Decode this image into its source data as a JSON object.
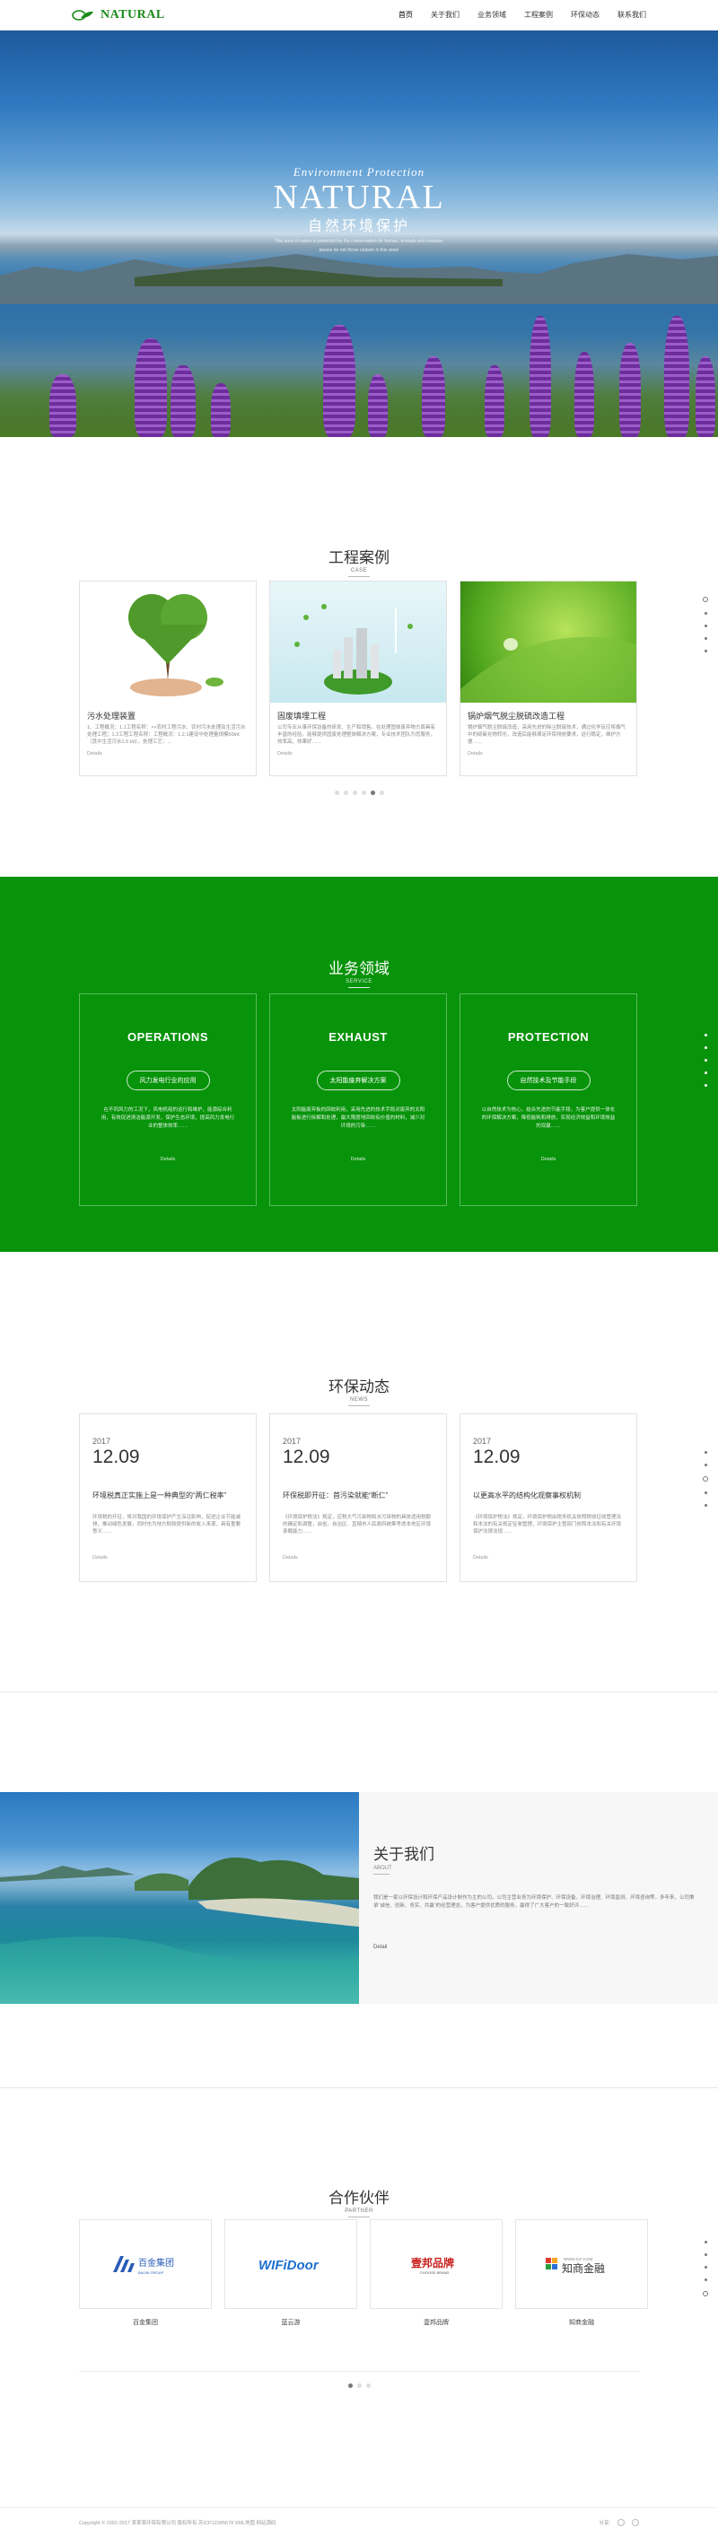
{
  "header": {
    "logo_text": "NATURAL",
    "nav": [
      "首页",
      "关于我们",
      "业务领域",
      "工程案例",
      "环保动态",
      "联系我们"
    ]
  },
  "hero": {
    "sub_en": "Environment Protection",
    "title": "NATURAL",
    "cn": "自然环境保护",
    "line1": "This area of nature is protected by the conservation for human, animals and creature.",
    "line2": "please do not throw rubbish in this area!"
  },
  "case": {
    "title": "工程案例",
    "en": "CASE",
    "cards": [
      {
        "name": "污水处理装置",
        "desc": "1、工程概况：1.1工程名称：××农村工程污水、农村污水处理及生活污水处理工程；1.2工程工程名称：工程概况：1.2.1建设中处理量规模50t/d（其中生活污水1.5 t/d），处理工艺：...",
        "more": "Details"
      },
      {
        "name": "固废填埋工程",
        "desc": "公司专业从事环保设备的研发、生产和销售。在处理固体废弃物方面具有丰富的经验，能够提供固废处理整体解决方案，专业技术团队为您服务，效率高，效果好……",
        "more": "Details"
      },
      {
        "name": "锅炉烟气脱尘脱硫改造工程",
        "desc": "锅炉烟气脱尘脱硫改造，采用先进的除尘脱硫技术，通过化学反应将烟气中的硫氧化物转化，改造后能够满足环保排放要求，运行稳定，维护方便……",
        "more": "Details"
      }
    ],
    "dots": 6,
    "active_dot": 4
  },
  "service": {
    "title": "业务领域",
    "en": "SERVICE",
    "cards": [
      {
        "name": "OPERATIONS",
        "pill": "风力发电行业的应用",
        "desc": "在不同风力的工况下，风电机组的运行和维护，能源综合利用，有效促进清洁能源开发，保护生态环境，提高风力发电行业的整体效率……",
        "more": "Details"
      },
      {
        "name": "EXHAUST",
        "pill": "太阳能废弃解决方案",
        "desc": "太阳能废弃板的回收利用，采用先进的技术手段对废弃的太阳能板进行拆解和处理，最大限度地回收有价值的材料，减少对环境的污染……",
        "more": "Details"
      },
      {
        "name": "PROTECTION",
        "pill": "自然技术及节能手段",
        "desc": "以自然技术为核心，结合先进的节能手段，为客户提供一体化的环保解决方案，降低能耗和排放，实现经济效益和环境效益的双赢……",
        "more": "Details"
      }
    ]
  },
  "news": {
    "title": "环保动态",
    "en": "NEWS",
    "cards": [
      {
        "year": "2017",
        "date": "12.09",
        "head": "环境税真正实施上是一种典型的“两仁税率”",
        "desc": "环境税的开征，将对我国的环境保护产生深远影响，促进企业节能减排，推动绿色发展，同时也为地方财政提供新的收入来源，具有重要意义……",
        "more": "Details"
      },
      {
        "year": "2017",
        "date": "12.09",
        "head": "环保税即开征：首污染就能“断仁”",
        "desc": "《环境保护税法》规定，应税大气污染物和水污染物的具体适用税额的确定和调整，由省、自治区、直辖市人民政府统筹考虑本地区环境承载能力……",
        "more": "Details"
      },
      {
        "year": "2017",
        "date": "12.09",
        "head": "以更高水平的结构化观察事权机制",
        "desc": "《环境保护税法》规定，环境保护税由税务机关依照税收征收管理法和本法的有关规定征收管理，环境保护主管部门依照本法和有关环境保护法律法规……",
        "more": "Details"
      }
    ]
  },
  "about": {
    "title": "关于我们",
    "en": "ABOUT",
    "text": "我们是一家以环保设计和环保产品设计制作为主的公司。公司主营业务为环境保护、环保设备、环境治理、环境监测、环境咨询等，多年来，公司秉承“诚信、创新、务实、共赢”的经营理念，为客户提供优质的服务，赢得了广大客户的一致好评……",
    "more": "Detail"
  },
  "partner": {
    "title": "合作伙伴",
    "en": "PARTNER",
    "items": [
      {
        "logo": "百金集团",
        "logo_en": "BAIJIN GROUP",
        "name": "百金集团"
      },
      {
        "logo": "WIFiDoor",
        "logo_en": "",
        "name": "蓝云游"
      },
      {
        "logo": "壹邦品牌",
        "logo_en": "CHOOSE BRAND",
        "name": "壹邦品牌"
      },
      {
        "logo": "知商金融",
        "logo_en": "WWW.ICF.COM",
        "name": "知商金融"
      }
    ],
    "dots": 3,
    "active_dot": 0
  },
  "footer": {
    "copyright": "Copyright © 2002-2017 某某某环保有限公司 版权所有  苏ICP12345678  XML地图  网站源码",
    "share_label": "分享:"
  },
  "colors": {
    "brand_green": "#07930a"
  }
}
